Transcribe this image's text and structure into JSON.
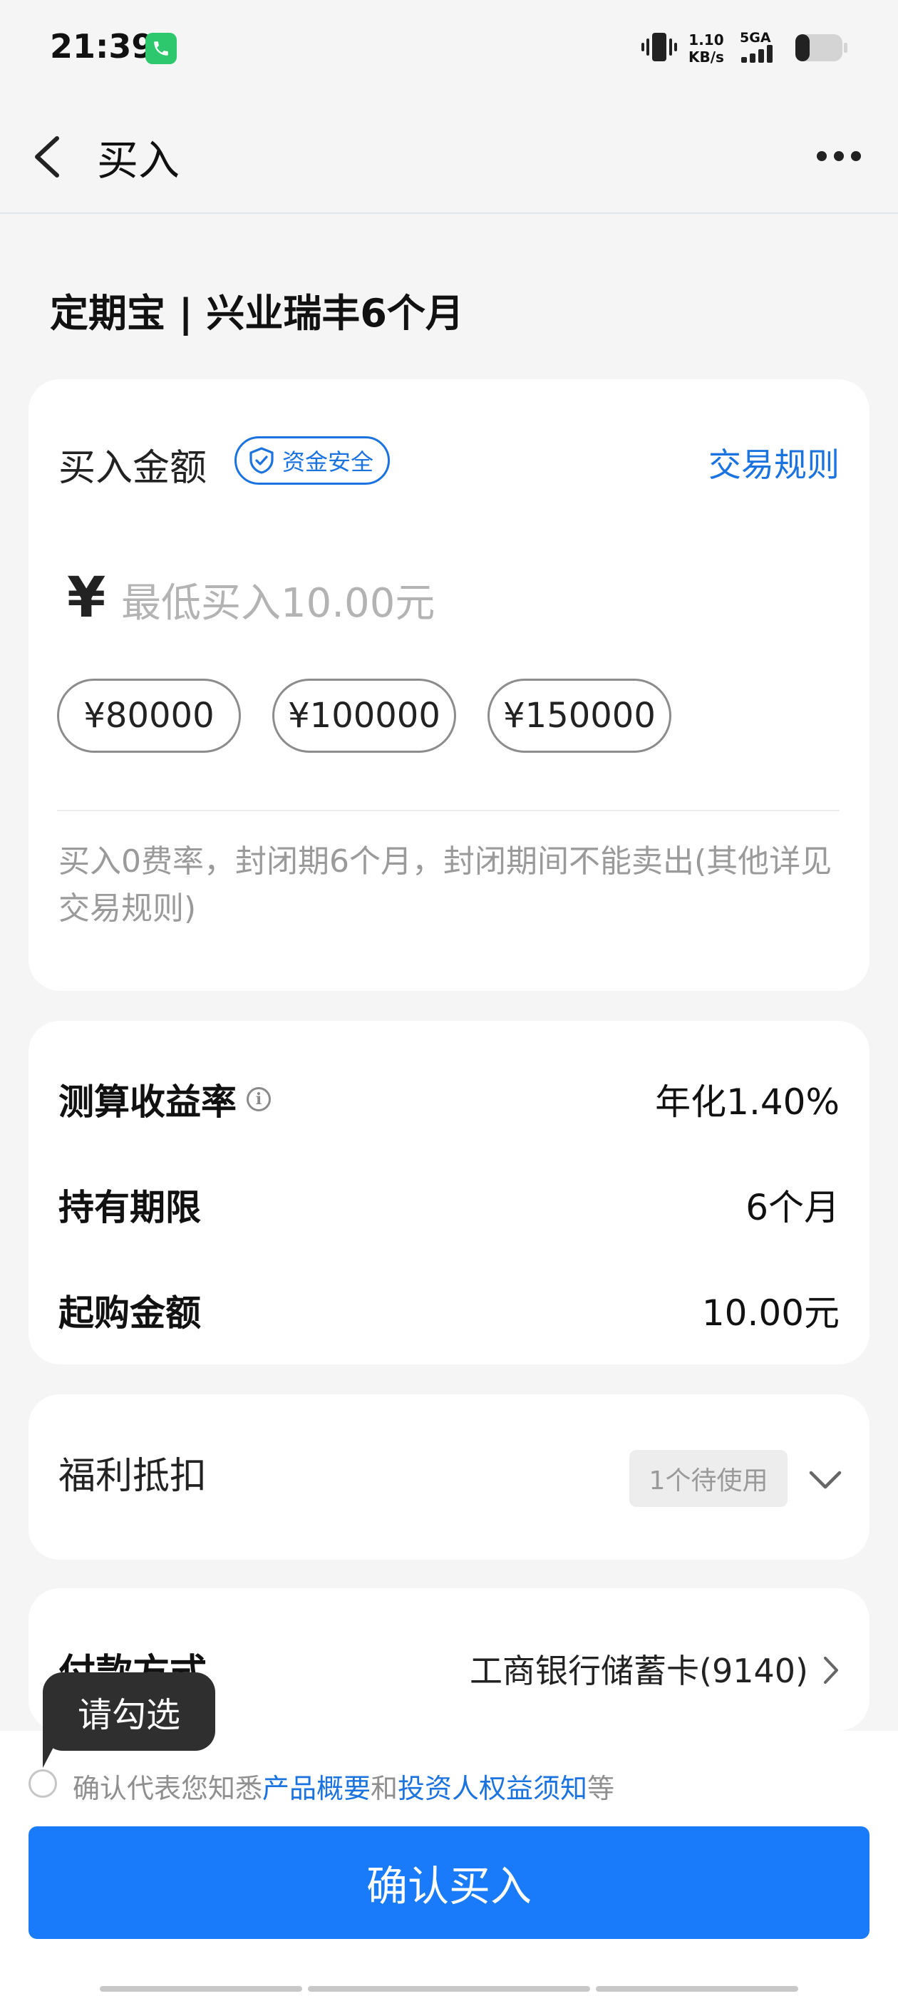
{
  "status_bar": {
    "time": "21:39",
    "net_speed_value": "1.10",
    "net_speed_unit": "KB/s",
    "network_type": "5GA"
  },
  "nav": {
    "title": "买入"
  },
  "product": {
    "title": "定期宝 | 兴业瑞丰6个月"
  },
  "amount": {
    "label": "买入金额",
    "safety_badge": "资金安全",
    "rules_link": "交易规则",
    "currency_symbol": "¥",
    "placeholder": "最低买入10.00元",
    "value": "",
    "quick_amounts": [
      "¥80000",
      "¥100000",
      "¥150000"
    ],
    "note": "买入0费率，封闭期6个月，封闭期间不能卖出(其他详见交易规则)"
  },
  "info": {
    "rate_label": "测算收益率",
    "rate_value": "年化1.40%",
    "period_label": "持有期限",
    "period_value": "6个月",
    "min_label": "起购金额",
    "min_value": "10.00元"
  },
  "welfare": {
    "label": "福利抵扣",
    "badge": "1个待使用"
  },
  "payment": {
    "label": "付款方式",
    "value": "工商银行储蓄卡(9140)"
  },
  "agreement": {
    "tooltip": "请勾选",
    "prefix": "确认代表您知悉",
    "link1": "产品概要",
    "mid": "和",
    "link2": "投资人权益须知",
    "suffix": "等"
  },
  "confirm": {
    "label": "确认买入"
  },
  "colors": {
    "primary": "#1a7bfa",
    "link": "#1b73e0",
    "background": "#f5f5f5"
  }
}
